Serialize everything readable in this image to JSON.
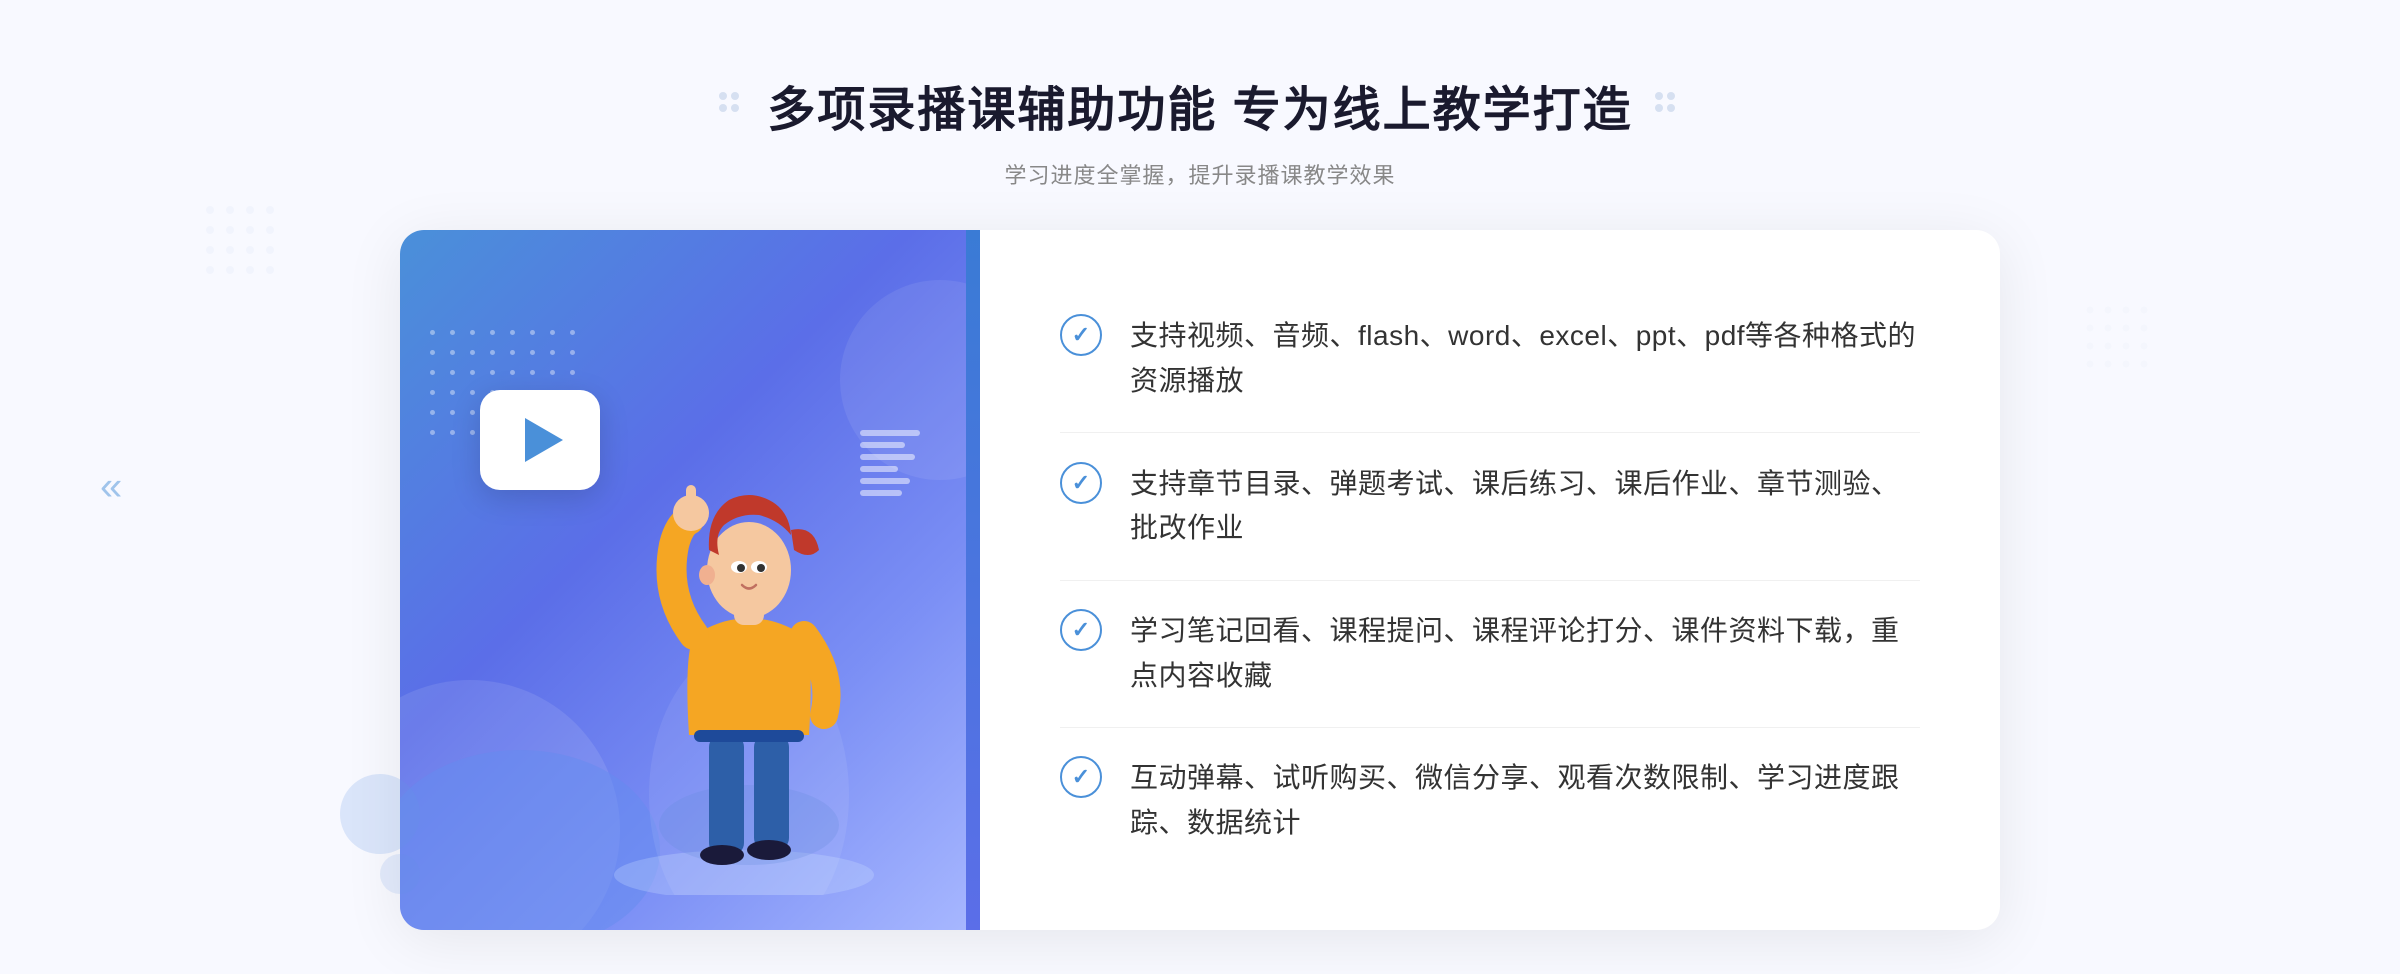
{
  "page": {
    "background_color": "#f4f6fc"
  },
  "header": {
    "title": "多项录播课辅助功能 专为线上教学打造",
    "subtitle": "学习进度全掌握，提升录播课教学效果",
    "title_decoration_left": "⠿",
    "title_decoration_right": "⠿"
  },
  "features": [
    {
      "id": 1,
      "text": "支持视频、音频、flash、word、excel、ppt、pdf等各种格式的资源播放"
    },
    {
      "id": 2,
      "text": "支持章节目录、弹题考试、课后练习、课后作业、章节测验、批改作业"
    },
    {
      "id": 3,
      "text": "学习笔记回看、课程提问、课程评论打分、课件资料下载，重点内容收藏"
    },
    {
      "id": 4,
      "text": "互动弹幕、试听购买、微信分享、观看次数限制、学习进度跟踪、数据统计"
    }
  ],
  "icons": {
    "check": "✓",
    "play": "▶",
    "chevron_left": "«",
    "dots": "⠿"
  },
  "colors": {
    "primary_blue": "#4a90d9",
    "secondary_blue": "#5b6ee8",
    "text_dark": "#333333",
    "text_gray": "#888888",
    "bg_light": "#f4f6fc",
    "white": "#ffffff",
    "divider": "#f0f0f0"
  }
}
